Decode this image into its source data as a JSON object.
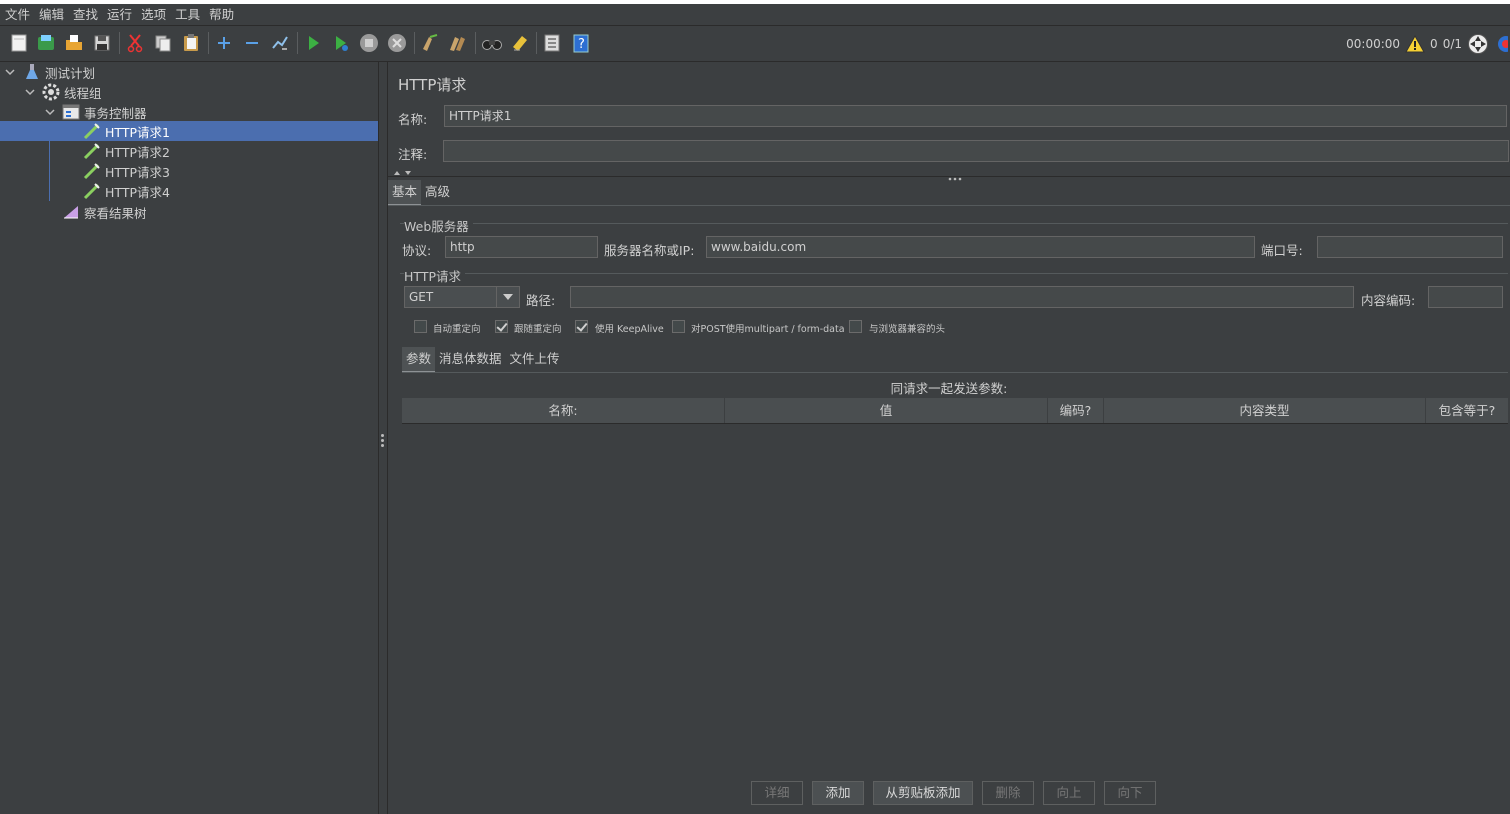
{
  "menu": [
    "文件",
    "编辑",
    "查找",
    "运行",
    "选项",
    "工具",
    "帮助"
  ],
  "toolbar_icons": [
    "new-icon",
    "templates-icon",
    "open-icon",
    "save-icon",
    "cut-icon",
    "copy-icon",
    "paste-icon",
    "expand-icon",
    "collapse-icon",
    "toggle-icon",
    "start-icon",
    "start-no-pause-icon",
    "stop-icon",
    "shutdown-icon",
    "clear-icon",
    "clear-all-icon",
    "search-icon",
    "reset-search-icon",
    "function-helper-icon",
    "help-icon"
  ],
  "status": {
    "time": "00:00:00",
    "warnings": "0",
    "threads": "0/1"
  },
  "tree": [
    {
      "label": "测试计划",
      "icon": "test-plan-icon"
    },
    {
      "label": "线程组",
      "icon": "thread-group-icon"
    },
    {
      "label": "事务控制器",
      "icon": "transaction-controller-icon"
    },
    {
      "label": "HTTP请求1",
      "icon": "http-sampler-icon",
      "selected": true
    },
    {
      "label": "HTTP请求2",
      "icon": "http-sampler-icon"
    },
    {
      "label": "HTTP请求3",
      "icon": "http-sampler-icon"
    },
    {
      "label": "HTTP请求4",
      "icon": "http-sampler-icon"
    },
    {
      "label": "察看结果树",
      "icon": "results-tree-icon"
    }
  ],
  "panel": {
    "title": "HTTP请求",
    "name_label": "名称:",
    "name_value": "HTTP请求1",
    "comment_label": "注释:",
    "comment_value": "",
    "tabs": [
      "基本",
      "高级"
    ],
    "web_server_group": "Web服务器",
    "protocol_label": "协议:",
    "protocol_value": "http",
    "server_label": "服务器名称或IP:",
    "server_value": "www.baidu.com",
    "port_label": "端口号:",
    "port_value": "",
    "http_group": "HTTP请求",
    "method": "GET",
    "path_label": "路径:",
    "path_value": "",
    "encoding_label": "内容编码:",
    "encoding_value": "",
    "checkboxes": [
      {
        "label": "自动重定向",
        "checked": false
      },
      {
        "label": "跟随重定向",
        "checked": true
      },
      {
        "label": "使用 KeepAlive",
        "checked": true
      },
      {
        "label": "对POST使用multipart / form-data",
        "checked": false
      },
      {
        "label": "与浏览器兼容的头",
        "checked": false
      }
    ],
    "sub_tabs": [
      "参数",
      "消息体数据",
      "文件上传"
    ],
    "params_caption": "同请求一起发送参数:",
    "columns": [
      "名称:",
      "值",
      "编码?",
      "内容类型",
      "包含等于?"
    ],
    "buttons": [
      {
        "label": "详细",
        "enabled": false
      },
      {
        "label": "添加",
        "enabled": true
      },
      {
        "label": "从剪贴板添加",
        "enabled": true
      },
      {
        "label": "删除",
        "enabled": false
      },
      {
        "label": "向上",
        "enabled": false
      },
      {
        "label": "向下",
        "enabled": false
      }
    ]
  }
}
